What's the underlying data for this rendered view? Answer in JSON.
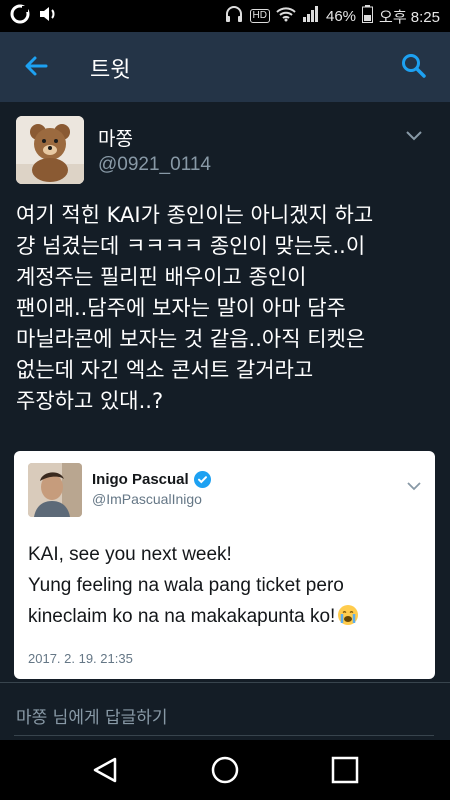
{
  "status_bar": {
    "battery": "46%",
    "time": "오후 8:25",
    "hd_label": "HD"
  },
  "app_bar": {
    "title": "트윗",
    "back_icon": "arrow-left-icon",
    "search_icon": "search-icon",
    "accent": "#1da1f2",
    "bg": "#243447"
  },
  "tweet": {
    "display_name": "마쫑",
    "handle": "@0921_0114",
    "body_lines": [
      "여기 적힌 KAI가 종인이는 아니겠지 하고",
      "걍 넘겼는데 ㅋㅋㅋㅋ 종인이 맞는듯..이",
      "계정주는 필리핀 배우이고 종인이",
      "팬이래..담주에 보자는 말이 아마 담주",
      "마닐라콘에 보자는 것 같음..아직 티켓은",
      "없는데 자긴 엑소 콘서트 갈거라고",
      "주장하고 있대..?"
    ]
  },
  "quoted": {
    "name": "Inigo Pascual",
    "handle": "@ImPascualInigo",
    "lines": [
      "KAI, see you next week!",
      "Yung feeling na wala pang ticket pero",
      "kineclaim ko na na makakapunta ko!"
    ],
    "date": "2017. 2. 19. 21:35",
    "verified_color": "#1da1f2"
  },
  "reply": {
    "placeholder": "마쫑 님에게 답글하기"
  },
  "colors": {
    "background": "#141d26",
    "secondary_text": "#8899a6"
  }
}
